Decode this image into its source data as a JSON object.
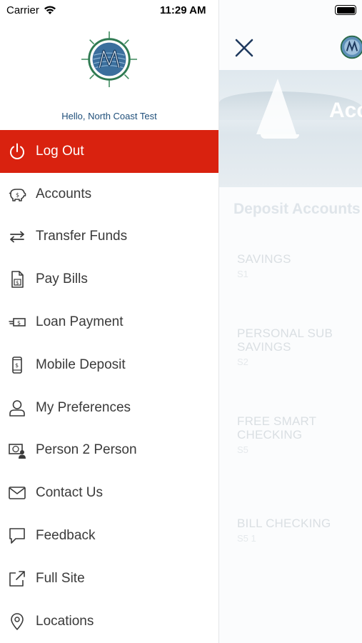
{
  "status_bar": {
    "carrier": "Carrier",
    "time": "11:29 AM"
  },
  "drawer": {
    "greeting": "Hello, North Coast Test",
    "menu": [
      {
        "label": "Log Out",
        "icon": "power-icon",
        "active": true
      },
      {
        "label": "Accounts",
        "icon": "piggy-bank-icon"
      },
      {
        "label": "Transfer Funds",
        "icon": "transfer-arrows-icon"
      },
      {
        "label": "Pay Bills",
        "icon": "bill-document-icon"
      },
      {
        "label": "Loan Payment",
        "icon": "cash-payment-icon"
      },
      {
        "label": "Mobile Deposit",
        "icon": "phone-dollar-icon"
      },
      {
        "label": "My Preferences",
        "icon": "user-icon"
      },
      {
        "label": "Person 2 Person",
        "icon": "person-money-icon"
      },
      {
        "label": "Contact Us",
        "icon": "envelope-icon"
      },
      {
        "label": "Feedback",
        "icon": "speech-bubble-icon"
      },
      {
        "label": "Full Site",
        "icon": "external-link-icon"
      },
      {
        "label": "Locations",
        "icon": "map-pin-icon"
      }
    ]
  },
  "background_page": {
    "hero_title": "Acc",
    "section_title": "Deposit Accounts",
    "accounts": [
      {
        "name": "SAVINGS",
        "number": "S1"
      },
      {
        "name": "PERSONAL SUB SAVINGS",
        "number": "S2"
      },
      {
        "name": "FREE SMART CHECKING",
        "number": "S5"
      },
      {
        "name": "BILL CHECKING",
        "number": "S5 1"
      }
    ]
  },
  "colors": {
    "accent_red": "#d9220f",
    "greeting_blue": "#1f4f7a",
    "close_icon_navy": "#1f3a5f"
  }
}
